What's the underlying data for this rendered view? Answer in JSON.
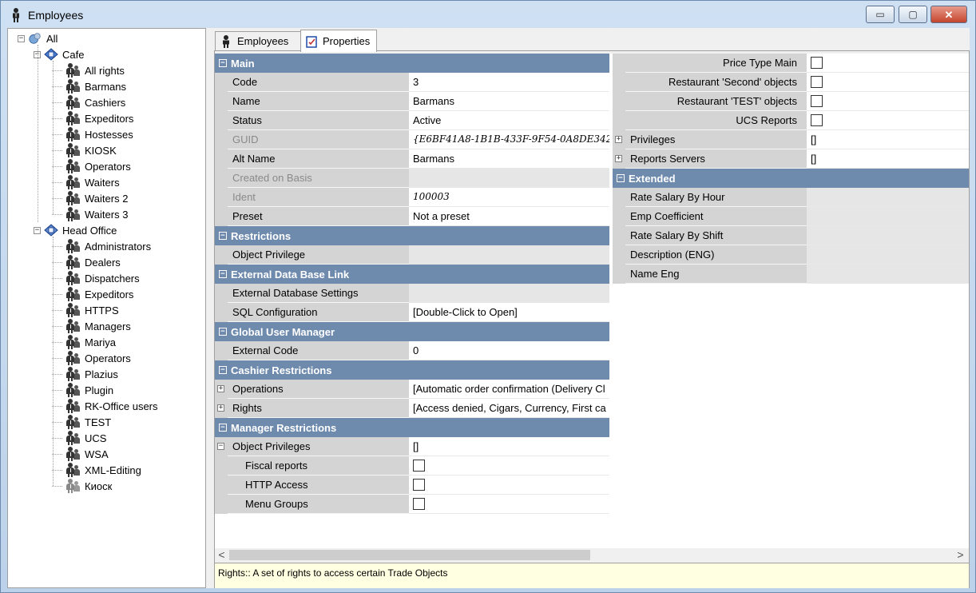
{
  "window": {
    "title": "Employees",
    "min_glyph": "▭",
    "max_glyph": "▢",
    "close_glyph": "✕"
  },
  "tree": {
    "root": "All",
    "groups": [
      {
        "label": "Cafe",
        "items": [
          "All rights",
          "Barmans",
          "Cashiers",
          "Expeditors",
          "Hostesses",
          "KIOSK",
          "Operators",
          "Waiters",
          "Waiters 2",
          "Waiters 3"
        ]
      },
      {
        "label": "Head Office",
        "items": [
          "Administrators",
          "Dealers",
          "Dispatchers",
          "Expeditors",
          "HTTPS",
          "Managers",
          "Mariya",
          "Operators",
          "Plazius",
          "Plugin",
          "RK-Office users",
          "TEST",
          "UCS",
          "WSA",
          "XML-Editing",
          "Киоск"
        ]
      }
    ]
  },
  "tabs": [
    "Employees",
    "Properties"
  ],
  "left_grid": {
    "main": {
      "title": "Main",
      "rows": [
        {
          "label": "Code",
          "value": "3"
        },
        {
          "label": "Name",
          "value": "Barmans"
        },
        {
          "label": "Status",
          "value": "Active"
        },
        {
          "label": "GUID",
          "value": "{E6BF41A8-1B1B-433F-9F54-0A8DE342"
        },
        {
          "label": "Alt Name",
          "value": "Barmans"
        },
        {
          "label": "Created on Basis",
          "value": ""
        },
        {
          "label": "Ident",
          "value": "100003"
        },
        {
          "label": "Preset",
          "value": "Not a preset"
        }
      ]
    },
    "restrictions": {
      "title": "Restrictions",
      "rows": [
        {
          "label": "Object Privilege",
          "value": ""
        }
      ]
    },
    "external": {
      "title": "External Data Base Link",
      "rows": [
        {
          "label": "External Database Settings",
          "value": ""
        },
        {
          "label": "SQL Configuration",
          "value": "[Double-Click to Open]"
        }
      ]
    },
    "global_user": {
      "title": "Global User Manager",
      "rows": [
        {
          "label": "External Code",
          "value": "0"
        }
      ]
    },
    "cashier": {
      "title": "Cashier Restrictions",
      "rows": [
        {
          "label": "Operations",
          "value": "[Automatic order confirmation (Delivery Cl"
        },
        {
          "label": "Rights",
          "value": "[Access denied, Cigars, Currency, First ca"
        }
      ]
    },
    "manager": {
      "title": "Manager Restrictions",
      "object_privileges": {
        "label": "Object Privileges",
        "value": "[]"
      },
      "subrows": [
        {
          "label": "Fiscal reports"
        },
        {
          "label": "HTTP Access"
        },
        {
          "label": "Menu Groups"
        }
      ]
    }
  },
  "right_grid": {
    "checkbox_rows": [
      {
        "label": "Price Type Main"
      },
      {
        "label": "Restaurant 'Second' objects"
      },
      {
        "label": "Restaurant 'TEST' objects"
      },
      {
        "label": "UCS Reports"
      }
    ],
    "expand_rows": [
      {
        "label": "Privileges",
        "value": "[]"
      },
      {
        "label": "Reports Servers",
        "value": "[]"
      }
    ],
    "extended": {
      "title": "Extended",
      "rows": [
        {
          "label": "Rate Salary By Hour",
          "value": ""
        },
        {
          "label": "Emp Coefficient",
          "value": ""
        },
        {
          "label": "Rate Salary By Shift",
          "value": ""
        },
        {
          "label": "Description (ENG)",
          "value": ""
        },
        {
          "label": "Name Eng",
          "value": ""
        }
      ]
    }
  },
  "scrollbar": {
    "left_arrow": "<",
    "right_arrow": ">"
  },
  "description": "Rights:: A set of rights to access certain Trade Objects",
  "glyphs": {
    "expand": "+",
    "collapse": "−"
  }
}
